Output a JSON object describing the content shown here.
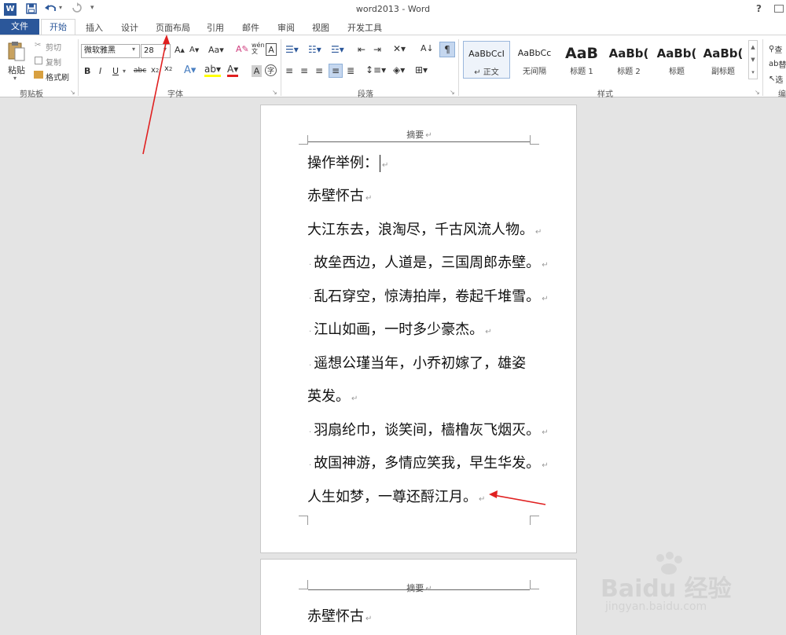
{
  "window": {
    "title": "word2013 - Word",
    "help": "?"
  },
  "qat": {
    "save": "save-icon",
    "undo": "undo-icon",
    "redo": "redo-icon",
    "customize": "▾"
  },
  "tabs": [
    {
      "label": "文件"
    },
    {
      "label": "开始"
    },
    {
      "label": "插入"
    },
    {
      "label": "设计"
    },
    {
      "label": "页面布局"
    },
    {
      "label": "引用"
    },
    {
      "label": "邮件"
    },
    {
      "label": "审阅"
    },
    {
      "label": "视图"
    },
    {
      "label": "开发工具"
    }
  ],
  "clipboard": {
    "paste": "粘贴",
    "cut": "剪切",
    "copy": "复制",
    "format_painter": "格式刷",
    "group": "剪贴板"
  },
  "font": {
    "name": "微软雅黑",
    "size": "28",
    "group": "字体"
  },
  "paragraph": {
    "group": "段落"
  },
  "styles": {
    "group": "样式",
    "items": [
      {
        "preview": "AaBbCcI",
        "name": "正文"
      },
      {
        "preview": "AaBbCc",
        "name": "无间隔"
      },
      {
        "preview": "AaB",
        "name": "标题 1"
      },
      {
        "preview": "AaBb(",
        "name": "标题 2"
      },
      {
        "preview": "AaBb(",
        "name": "标题"
      },
      {
        "preview": "AaBb(",
        "name": "副标题"
      }
    ]
  },
  "editing": {
    "find": "查",
    "replace": "替",
    "select": "选",
    "group": "编"
  },
  "header_label": "摘要",
  "page1_lines": [
    "操作举例：",
    "赤壁怀古",
    "大江东去，浪淘尽，千古风流人物。",
    "故垒西边，人道是，三国周郎赤壁。",
    "乱石穿空，惊涛拍岸，卷起千堆雪。",
    "江山如画，一时多少豪杰。",
    "遥想公瑾当年，小乔初嫁了，雄姿",
    "英发。",
    "羽扇纶巾，谈笑间，樯橹灰飞烟灭。",
    "故国神游，多情应笑我，早生华发。",
    "人生如梦，一尊还酹江月。"
  ],
  "page2_lines": [
    "赤壁怀古"
  ],
  "watermark": {
    "brand": "Baidu 经验",
    "url": "jingyan.baidu.com"
  },
  "colors": {
    "file_tab": "#2b579a",
    "annotation": "#e02020",
    "accent": "#2b579a"
  }
}
